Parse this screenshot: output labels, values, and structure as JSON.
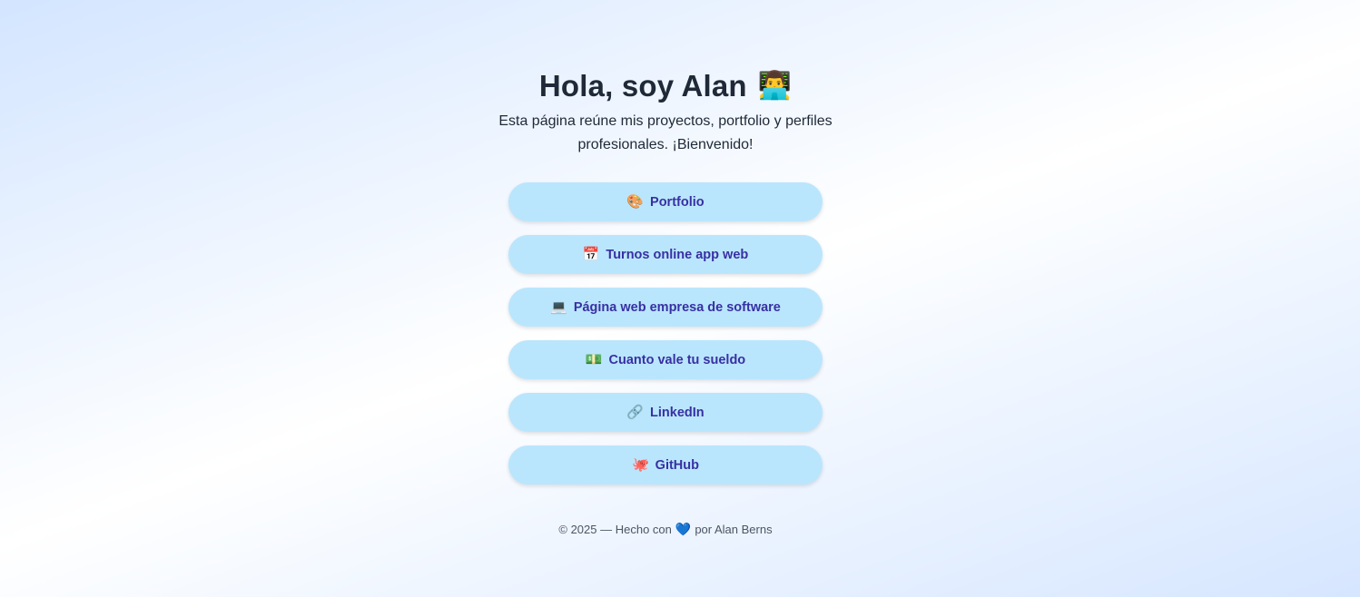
{
  "header": {
    "title": "Hola, soy Alan",
    "title_emoji": "👨‍💻",
    "subtitle": "Esta página reúne mis proyectos, portfolio y perfiles profesionales. ¡Bienvenido!"
  },
  "links": [
    {
      "icon": "🎨",
      "icon_name": "palette-icon",
      "label": "Portfolio"
    },
    {
      "icon": "📅",
      "icon_name": "calendar-icon",
      "label": "Turnos online app web"
    },
    {
      "icon": "💻",
      "icon_name": "laptop-icon",
      "label": "Página web empresa de software"
    },
    {
      "icon": "💵",
      "icon_name": "money-icon",
      "label": "Cuanto vale tu sueldo"
    },
    {
      "icon": "🔗",
      "icon_name": "link-icon",
      "label": "LinkedIn"
    },
    {
      "icon": "🐙",
      "icon_name": "octopus-icon",
      "label": "GitHub"
    }
  ],
  "footer": {
    "prefix": "© 2025 — Hecho con",
    "heart": "💙",
    "suffix": "por Alan Berns"
  },
  "colors": {
    "button_bg": "#bae6fd",
    "button_text": "#3730a3",
    "heading_text": "#1f2937"
  }
}
